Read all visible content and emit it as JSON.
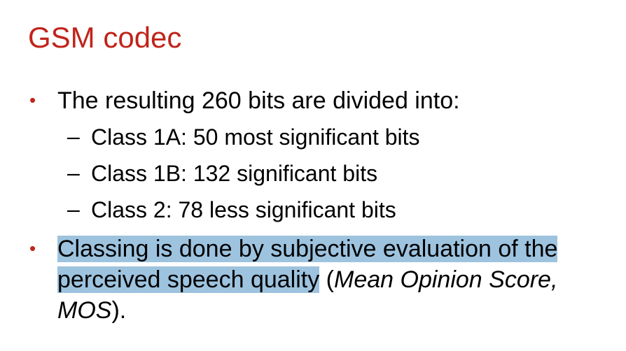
{
  "title": "GSM codec",
  "colors": {
    "title": "#c0241b",
    "bullet": "#c0241b",
    "highlight": "#9dc3df"
  },
  "bullets": [
    {
      "marker": "•",
      "text": "The resulting 260 bits are divided into:",
      "subitems": [
        {
          "marker": "–",
          "text": "Class 1A: 50 most significant bits"
        },
        {
          "marker": "–",
          "text": "Class 1B: 132 significant bits"
        },
        {
          "marker": "–",
          "text": "Class 2: 78 less significant bits"
        }
      ]
    },
    {
      "marker": "•",
      "line1_highlight": "Classing is done by subjective evaluation of the",
      "line2_highlight": "perceived speech quality",
      "line2_rest_prefix": " (",
      "line2_italic": "Mean Opinion Score,",
      "line3_italic": "MOS",
      "line3_rest": ")."
    }
  ]
}
